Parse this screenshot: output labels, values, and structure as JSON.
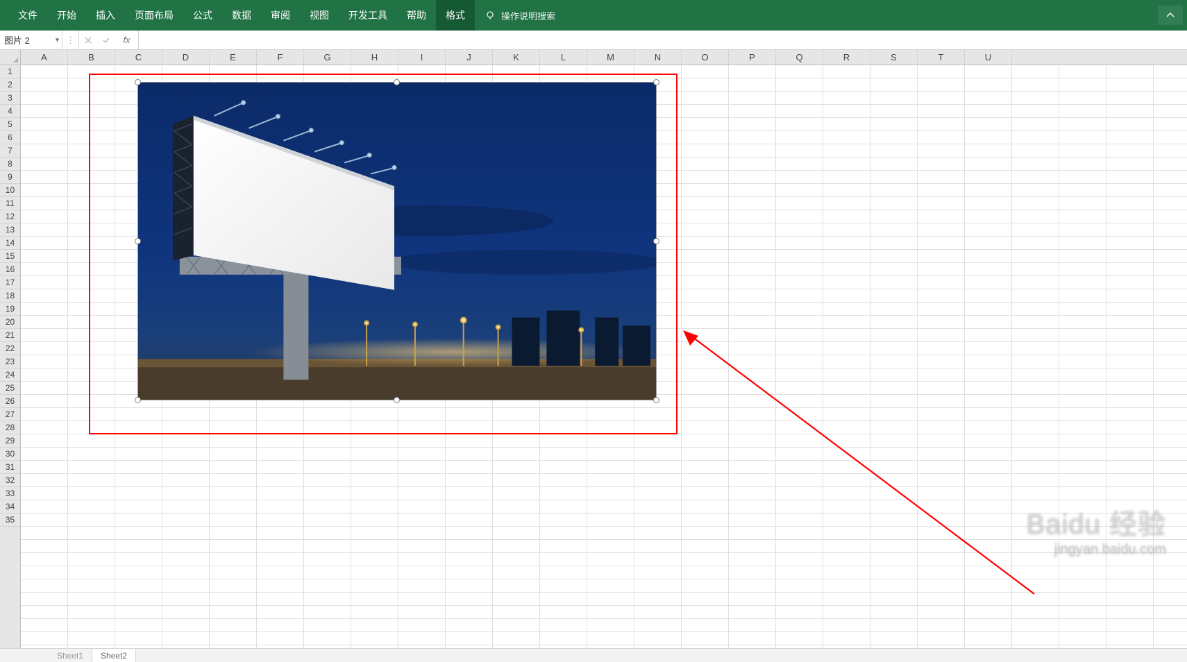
{
  "ribbon": {
    "tabs": [
      "文件",
      "开始",
      "插入",
      "页面布局",
      "公式",
      "数据",
      "审阅",
      "视图",
      "开发工具",
      "帮助"
    ],
    "context_tab": "格式",
    "tell_me": "操作说明搜索"
  },
  "name_box": {
    "value": "图片 2"
  },
  "fx_label": "fx",
  "formula_bar": {
    "value": ""
  },
  "columns": [
    "A",
    "B",
    "C",
    "D",
    "E",
    "F",
    "G",
    "H",
    "I",
    "J",
    "K",
    "L",
    "M",
    "N",
    "O",
    "P",
    "Q",
    "R",
    "S",
    "T",
    "U"
  ],
  "row_count": 35,
  "sheet_tabs": {
    "inactive": "Sheet1",
    "active": "Sheet2"
  },
  "watermark": {
    "main": "Baidu 经验",
    "sub": "jingyan.baidu.com"
  },
  "image": {
    "alt": "Billboard at night against dark blue sky with city lights"
  }
}
